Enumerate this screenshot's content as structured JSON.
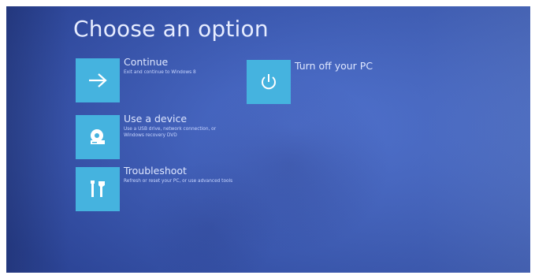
{
  "screen": {
    "title": "Choose an option"
  },
  "options": [
    {
      "label": "Continue",
      "description": "Exit and continue to Windows 8",
      "icon": "arrow-right-icon"
    },
    {
      "label": "Use a device",
      "description": "Use a USB drive, network connection, or Windows recovery DVD",
      "icon": "disc-drive-icon"
    },
    {
      "label": "Troubleshoot",
      "description": "Refresh or reset your PC, or use advanced tools",
      "icon": "tools-icon"
    },
    {
      "label": "Turn off your PC",
      "description": "",
      "icon": "power-icon"
    }
  ],
  "colors": {
    "background": "#4266c8",
    "tile": "#45b3df",
    "text": "#dfe7ff"
  }
}
